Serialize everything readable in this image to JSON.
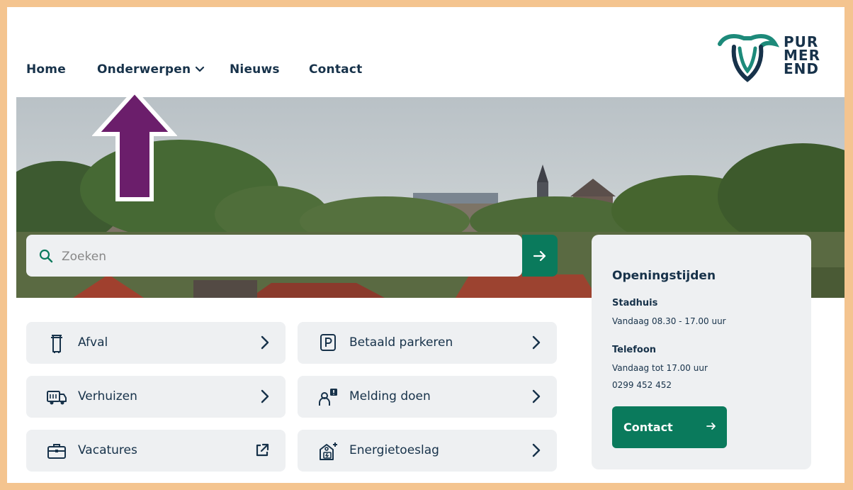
{
  "nav": {
    "home": "Home",
    "onderwerpen": "Onderwerpen",
    "nieuws": "Nieuws",
    "contact": "Contact"
  },
  "logo": {
    "line1": "PUR",
    "line2": "MER",
    "line3": "END"
  },
  "search": {
    "placeholder": "Zoeken",
    "icon": "search-icon",
    "submit_icon": "arrow-right-icon"
  },
  "tiles": [
    {
      "label": "Afval",
      "icon": "trash-bin-icon",
      "trail": "chevron-right-icon"
    },
    {
      "label": "Betaald parkeren",
      "icon": "parking-icon",
      "trail": "chevron-right-icon"
    },
    {
      "label": "Verhuizen",
      "icon": "moving-truck-icon",
      "trail": "chevron-right-icon"
    },
    {
      "label": "Melding doen",
      "icon": "report-icon",
      "trail": "chevron-right-icon"
    },
    {
      "label": "Vacatures",
      "icon": "briefcase-icon",
      "trail": "external-link-icon"
    },
    {
      "label": "Energietoeslag",
      "icon": "energy-house-icon",
      "trail": "chevron-right-icon"
    }
  ],
  "hours": {
    "title": "Openingstijden",
    "stadhuis_label": "Stadhuis",
    "stadhuis_text": "Vandaag 08.30 - 17.00 uur",
    "telefoon_label": "Telefoon",
    "telefoon_text": "Vandaag tot 17.00 uur",
    "telefoon_number": "0299 452 452",
    "button_label": "Contact"
  },
  "colors": {
    "brand_green": "#0a7a5c",
    "navy": "#17324a",
    "tile_bg": "#eef0f2",
    "frame": "#f4c48f",
    "annotation_arrow": "#6b1e6b"
  }
}
